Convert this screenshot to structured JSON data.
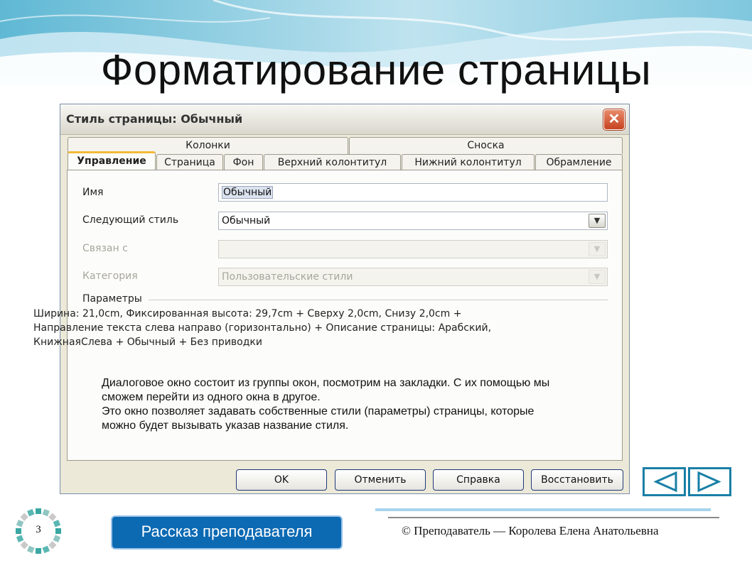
{
  "slide": {
    "title": "Форматирование страницы",
    "page_number": "3",
    "teacher_button": "Рассказ преподавателя",
    "copyright": "© Преподаватель — Королева Елена Анатольевна",
    "note": "Диалоговое окно состоит из группы окон, посмотрим на закладки.  С их помощью мы сможем перейти из одного окна в другое.\nЭто окно позволяет задавать собственные стили (параметры) страницы, которые можно будет вызывать указав название стиля.",
    "nav": {
      "prev_icon": "triangle-left-icon",
      "next_icon": "triangle-right-icon"
    },
    "colors": {
      "accent": "#1a7fa6",
      "button": "#0c6ab3",
      "tab_highlight": "#f2b93a"
    }
  },
  "dialog": {
    "title": "Стиль страницы: Обычный",
    "close_icon": "close-icon",
    "tabs_back": [
      "Колонки",
      "Сноска"
    ],
    "tabs_front": [
      "Управление",
      "Страница",
      "Фон",
      "Верхний колонтитул",
      "Нижний колонтитул",
      "Обрамление"
    ],
    "active_tab": "Управление",
    "fields": {
      "name_label": "Имя",
      "name_value": "Обычный",
      "next_style_label": "Следующий стиль",
      "next_style_value": "Обычный",
      "linked_label": "Связан с",
      "linked_value": "",
      "category_label": "Категория",
      "category_value": "Пользовательские стили"
    },
    "params_label": "Параметры",
    "params_text": "Ширина: 21,0cm, Фиксированная высота: 29,7cm + Сверху 2,0cm, Снизу 2,0cm +\nНаправление текста слева направо (горизонтально) + Описание страницы: Арабский,\nКнижнаяСлева + Обычный + Без приводки",
    "buttons": {
      "ok": "OK",
      "cancel": "Отменить",
      "help": "Справка",
      "reset": "Восстановить"
    }
  }
}
